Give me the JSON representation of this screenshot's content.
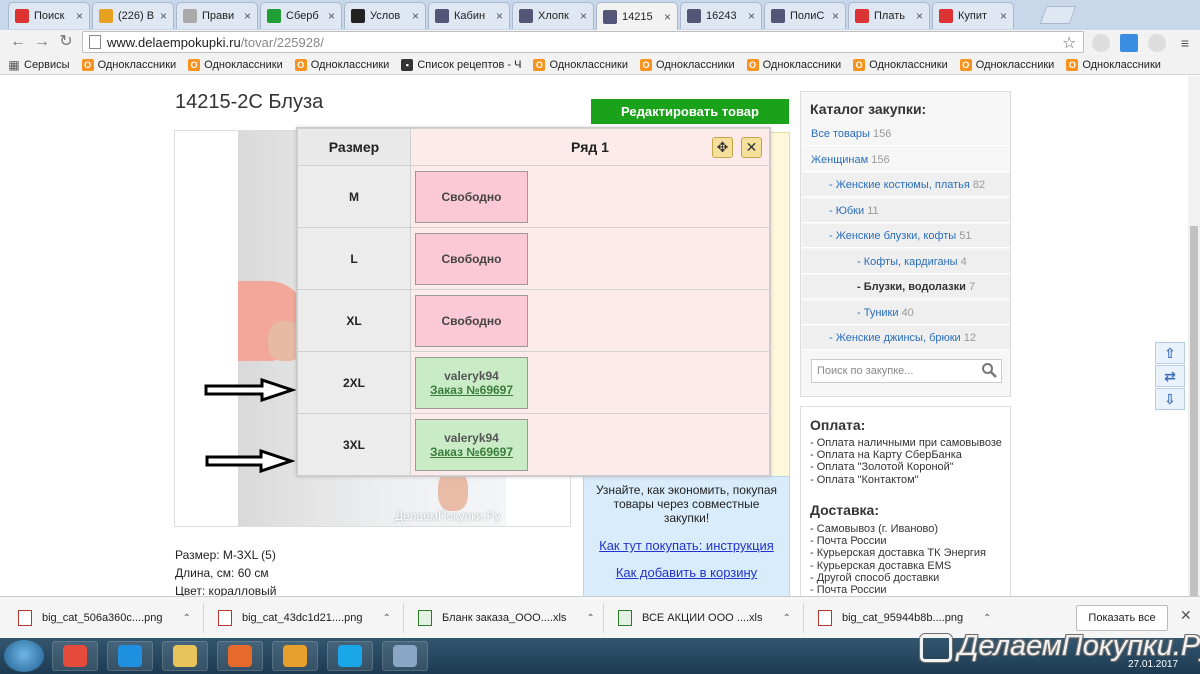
{
  "browser": {
    "tabs": [
      {
        "label": "Поиск",
        "favicon": "russian-flag-icon",
        "color": "#d33"
      },
      {
        "label": "(226) В",
        "favicon": "vk-circle-icon",
        "color": "#e8a020"
      },
      {
        "label": "Прави",
        "favicon": "grey-circle-icon",
        "color": "#aaa"
      },
      {
        "label": "Сберб",
        "favicon": "sber-icon",
        "color": "#21a038"
      },
      {
        "label": "Услов",
        "favicon": "cat-icon",
        "color": "#222"
      },
      {
        "label": "Кабин",
        "favicon": "page-icon",
        "color": "#557"
      },
      {
        "label": "Хлопк",
        "favicon": "page-icon",
        "color": "#557"
      },
      {
        "label": "14215",
        "favicon": "page-icon",
        "color": "#557"
      },
      {
        "label": "16243",
        "favicon": "page-icon",
        "color": "#557"
      },
      {
        "label": "ПолиС",
        "favicon": "page-icon",
        "color": "#557"
      },
      {
        "label": "Плать",
        "favicon": "russian-flag-icon",
        "color": "#d33"
      },
      {
        "label": "Купит",
        "favicon": "balloon-icon",
        "color": "#d33"
      }
    ],
    "url_host": "www.delaempokupki.ru",
    "url_path": "/tovar/225928/",
    "bookmarks": [
      {
        "label": "Сервисы",
        "icon": "apps-icon"
      },
      {
        "label": "Одноклассники",
        "icon": "ok-icon"
      },
      {
        "label": "Одноклассники",
        "icon": "ok-icon"
      },
      {
        "label": "Одноклассники",
        "icon": "ok-icon"
      },
      {
        "label": "Список рецептов - Ч",
        "icon": "recipe-icon"
      },
      {
        "label": "Одноклассники",
        "icon": "ok-icon"
      },
      {
        "label": "Одноклассники",
        "icon": "ok-icon"
      },
      {
        "label": "Одноклассники",
        "icon": "ok-icon"
      },
      {
        "label": "Одноклассники",
        "icon": "ok-icon"
      },
      {
        "label": "Одноклассники",
        "icon": "ok-icon"
      },
      {
        "label": "Одноклассники",
        "icon": "ok-icon"
      }
    ]
  },
  "product": {
    "title": "14215-2С Блуза",
    "edit_button": "Редактировать товар",
    "watermark": "ДелаемПокупки.Ру",
    "specs": [
      "Размер: M-3XL (5)",
      "Длина, см: 60 см",
      "Цвет: коралловый"
    ]
  },
  "popup": {
    "col_size": "Размер",
    "col_row": "Ряд 1",
    "rows": [
      {
        "size": "M",
        "status": "free",
        "text": "Свободно"
      },
      {
        "size": "L",
        "status": "free",
        "text": "Свободно"
      },
      {
        "size": "XL",
        "status": "free",
        "text": "Свободно"
      },
      {
        "size": "2XL",
        "status": "taken",
        "user": "valeryk94",
        "order": "Заказ №69697"
      },
      {
        "size": "3XL",
        "status": "taken",
        "user": "valeryk94",
        "order": "Заказ №69697"
      }
    ]
  },
  "info": {
    "text": "Узнайте, как экономить, покупая товары через совместные закупки!",
    "link1": "Как тут покупать: инструкция",
    "link2": "Как добавить в корзину"
  },
  "catalog": {
    "title": "Каталог закупки:",
    "items": [
      {
        "label": "Все товары",
        "count": "156",
        "level": 0
      },
      {
        "label": "Женщинам",
        "count": "156",
        "level": 0
      },
      {
        "label": "- Женские костюмы, платья",
        "count": "82",
        "level": 1
      },
      {
        "label": "- Юбки",
        "count": "11",
        "level": 1
      },
      {
        "label": "- Женские блузки, кофты",
        "count": "51",
        "level": 1
      },
      {
        "label": "- Кофты, кардиганы",
        "count": "4",
        "level": 2
      },
      {
        "label": "- Блузки, водолазки",
        "count": "7",
        "level": 2,
        "active": true
      },
      {
        "label": "- Туники",
        "count": "40",
        "level": 2
      },
      {
        "label": "- Женские джинсы, брюки",
        "count": "12",
        "level": 1
      }
    ],
    "search_placeholder": "Поиск по закупке..."
  },
  "payment": {
    "title": "Оплата:",
    "items": [
      "- Оплата наличными при самовывозе",
      "- Оплата на Карту СберБанка",
      "- Оплата \"Золотой Короной\"",
      "- Оплата \"Контактом\""
    ]
  },
  "delivery": {
    "title": "Доставка:",
    "items": [
      "- Самовывоз (г. Иваново)",
      "- Почта России",
      "- Курьерская доставка ТК Энергия",
      "- Курьерская доставка EMS",
      "- Другой способ доставки",
      "- Почта России"
    ]
  },
  "downloads": {
    "items": [
      {
        "name": "big_cat_506a360c....png",
        "type": "png"
      },
      {
        "name": "big_cat_43dc1d21....png",
        "type": "png"
      },
      {
        "name": "Бланк заказа_ООО....xls",
        "type": "xls"
      },
      {
        "name": "ВСЕ АКЦИИ ООО ....xls",
        "type": "xls"
      },
      {
        "name": "big_cat_95944b8b....png",
        "type": "png"
      }
    ],
    "show_all": "Показать все"
  },
  "taskbar": {
    "date": "27.01.2017",
    "brand": "ДелаемПокупки.Ру",
    "apps": [
      "chrome-icon",
      "ie-icon",
      "folder-icon",
      "paint-icon",
      "media-player-icon",
      "skype-icon",
      "calculator-icon"
    ]
  },
  "colors": {
    "edit_button": "#1aa31a",
    "slot_free": "#fbc9d6",
    "slot_taken": "#c9ecc6",
    "link": "#2a6ebb"
  }
}
